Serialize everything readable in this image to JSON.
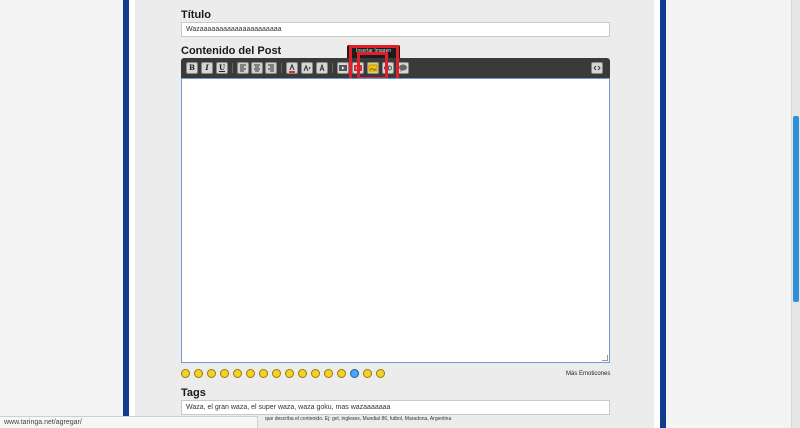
{
  "form": {
    "title_label": "Título",
    "title_value": "Wazaaaaaaaaaaaaaaaaaaaaa",
    "content_label": "Contenido del Post",
    "tags_label": "Tags",
    "tags_value": "Waza, el gran waza, el super waza, waza goku, mas wazaaaaaaa",
    "tags_hint": "que describa el contenido. Ej: gol, ingleses, Mundial 86, futbol, Maradona, Argentina"
  },
  "toolbar": {
    "bold": "B",
    "italic": "I",
    "underline": "U",
    "tooltip": "Insertar Imagen"
  },
  "emoticons": {
    "more_label": "Más Emoticones"
  },
  "status": {
    "url": "www.taringa.net/agregar/"
  }
}
